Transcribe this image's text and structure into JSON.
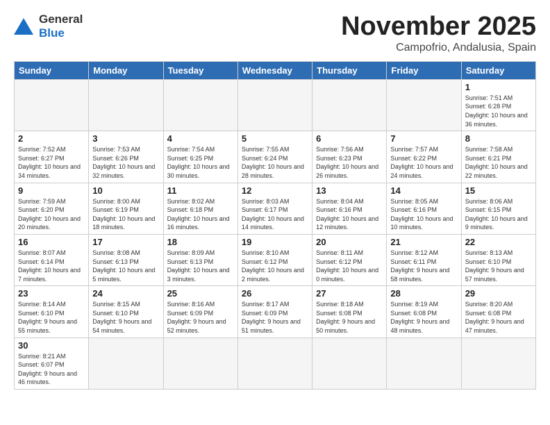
{
  "logo": {
    "line1": "General",
    "line2": "Blue"
  },
  "title": "November 2025",
  "subtitle": "Campofrio, Andalusia, Spain",
  "weekdays": [
    "Sunday",
    "Monday",
    "Tuesday",
    "Wednesday",
    "Thursday",
    "Friday",
    "Saturday"
  ],
  "weeks": [
    [
      {
        "day": "",
        "info": ""
      },
      {
        "day": "",
        "info": ""
      },
      {
        "day": "",
        "info": ""
      },
      {
        "day": "",
        "info": ""
      },
      {
        "day": "",
        "info": ""
      },
      {
        "day": "",
        "info": ""
      },
      {
        "day": "1",
        "info": "Sunrise: 7:51 AM\nSunset: 6:28 PM\nDaylight: 10 hours\nand 36 minutes."
      }
    ],
    [
      {
        "day": "2",
        "info": "Sunrise: 7:52 AM\nSunset: 6:27 PM\nDaylight: 10 hours\nand 34 minutes."
      },
      {
        "day": "3",
        "info": "Sunrise: 7:53 AM\nSunset: 6:26 PM\nDaylight: 10 hours\nand 32 minutes."
      },
      {
        "day": "4",
        "info": "Sunrise: 7:54 AM\nSunset: 6:25 PM\nDaylight: 10 hours\nand 30 minutes."
      },
      {
        "day": "5",
        "info": "Sunrise: 7:55 AM\nSunset: 6:24 PM\nDaylight: 10 hours\nand 28 minutes."
      },
      {
        "day": "6",
        "info": "Sunrise: 7:56 AM\nSunset: 6:23 PM\nDaylight: 10 hours\nand 26 minutes."
      },
      {
        "day": "7",
        "info": "Sunrise: 7:57 AM\nSunset: 6:22 PM\nDaylight: 10 hours\nand 24 minutes."
      },
      {
        "day": "8",
        "info": "Sunrise: 7:58 AM\nSunset: 6:21 PM\nDaylight: 10 hours\nand 22 minutes."
      }
    ],
    [
      {
        "day": "9",
        "info": "Sunrise: 7:59 AM\nSunset: 6:20 PM\nDaylight: 10 hours\nand 20 minutes."
      },
      {
        "day": "10",
        "info": "Sunrise: 8:00 AM\nSunset: 6:19 PM\nDaylight: 10 hours\nand 18 minutes."
      },
      {
        "day": "11",
        "info": "Sunrise: 8:02 AM\nSunset: 6:18 PM\nDaylight: 10 hours\nand 16 minutes."
      },
      {
        "day": "12",
        "info": "Sunrise: 8:03 AM\nSunset: 6:17 PM\nDaylight: 10 hours\nand 14 minutes."
      },
      {
        "day": "13",
        "info": "Sunrise: 8:04 AM\nSunset: 6:16 PM\nDaylight: 10 hours\nand 12 minutes."
      },
      {
        "day": "14",
        "info": "Sunrise: 8:05 AM\nSunset: 6:16 PM\nDaylight: 10 hours\nand 10 minutes."
      },
      {
        "day": "15",
        "info": "Sunrise: 8:06 AM\nSunset: 6:15 PM\nDaylight: 10 hours\nand 9 minutes."
      }
    ],
    [
      {
        "day": "16",
        "info": "Sunrise: 8:07 AM\nSunset: 6:14 PM\nDaylight: 10 hours\nand 7 minutes."
      },
      {
        "day": "17",
        "info": "Sunrise: 8:08 AM\nSunset: 6:13 PM\nDaylight: 10 hours\nand 5 minutes."
      },
      {
        "day": "18",
        "info": "Sunrise: 8:09 AM\nSunset: 6:13 PM\nDaylight: 10 hours\nand 3 minutes."
      },
      {
        "day": "19",
        "info": "Sunrise: 8:10 AM\nSunset: 6:12 PM\nDaylight: 10 hours\nand 2 minutes."
      },
      {
        "day": "20",
        "info": "Sunrise: 8:11 AM\nSunset: 6:12 PM\nDaylight: 10 hours\nand 0 minutes."
      },
      {
        "day": "21",
        "info": "Sunrise: 8:12 AM\nSunset: 6:11 PM\nDaylight: 9 hours\nand 58 minutes."
      },
      {
        "day": "22",
        "info": "Sunrise: 8:13 AM\nSunset: 6:10 PM\nDaylight: 9 hours\nand 57 minutes."
      }
    ],
    [
      {
        "day": "23",
        "info": "Sunrise: 8:14 AM\nSunset: 6:10 PM\nDaylight: 9 hours\nand 55 minutes."
      },
      {
        "day": "24",
        "info": "Sunrise: 8:15 AM\nSunset: 6:10 PM\nDaylight: 9 hours\nand 54 minutes."
      },
      {
        "day": "25",
        "info": "Sunrise: 8:16 AM\nSunset: 6:09 PM\nDaylight: 9 hours\nand 52 minutes."
      },
      {
        "day": "26",
        "info": "Sunrise: 8:17 AM\nSunset: 6:09 PM\nDaylight: 9 hours\nand 51 minutes."
      },
      {
        "day": "27",
        "info": "Sunrise: 8:18 AM\nSunset: 6:08 PM\nDaylight: 9 hours\nand 50 minutes."
      },
      {
        "day": "28",
        "info": "Sunrise: 8:19 AM\nSunset: 6:08 PM\nDaylight: 9 hours\nand 48 minutes."
      },
      {
        "day": "29",
        "info": "Sunrise: 8:20 AM\nSunset: 6:08 PM\nDaylight: 9 hours\nand 47 minutes."
      }
    ],
    [
      {
        "day": "30",
        "info": "Sunrise: 8:21 AM\nSunset: 6:07 PM\nDaylight: 9 hours\nand 46 minutes."
      },
      {
        "day": "",
        "info": ""
      },
      {
        "day": "",
        "info": ""
      },
      {
        "day": "",
        "info": ""
      },
      {
        "day": "",
        "info": ""
      },
      {
        "day": "",
        "info": ""
      },
      {
        "day": "",
        "info": ""
      }
    ]
  ]
}
